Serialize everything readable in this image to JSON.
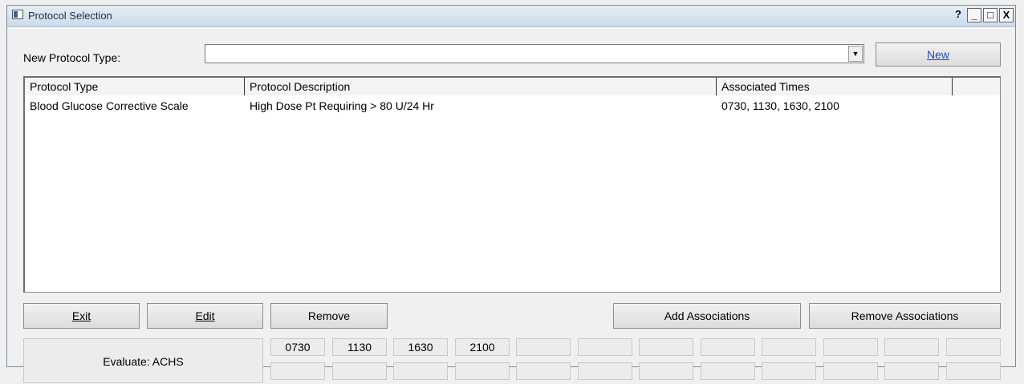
{
  "window": {
    "title": "Protocol Selection",
    "help": "?",
    "minimize": "_",
    "maximize": "□",
    "close": "X"
  },
  "new_protocol": {
    "label": "New Protocol Type:",
    "value": "",
    "new_button": "New"
  },
  "table": {
    "columns": [
      "Protocol Type",
      "Protocol Description",
      "Associated Times"
    ],
    "rows": [
      [
        "Blood Glucose Corrective Scale",
        "High Dose Pt Requiring > 80 U/24 Hr",
        "0730, 1130, 1630, 2100"
      ]
    ]
  },
  "buttons": {
    "exit": "Exit",
    "edit": "Edit",
    "remove": "Remove",
    "add_associations": "Add Associations",
    "remove_associations": "Remove Associations"
  },
  "evaluate": "Evaluate:  ACHS",
  "times_row1": [
    "0730",
    "1130",
    "1630",
    "2100",
    "",
    "",
    "",
    "",
    "",
    "",
    "",
    ""
  ],
  "times_row2": [
    "",
    "",
    "",
    "",
    "",
    "",
    "",
    "",
    "",
    "",
    "",
    ""
  ]
}
